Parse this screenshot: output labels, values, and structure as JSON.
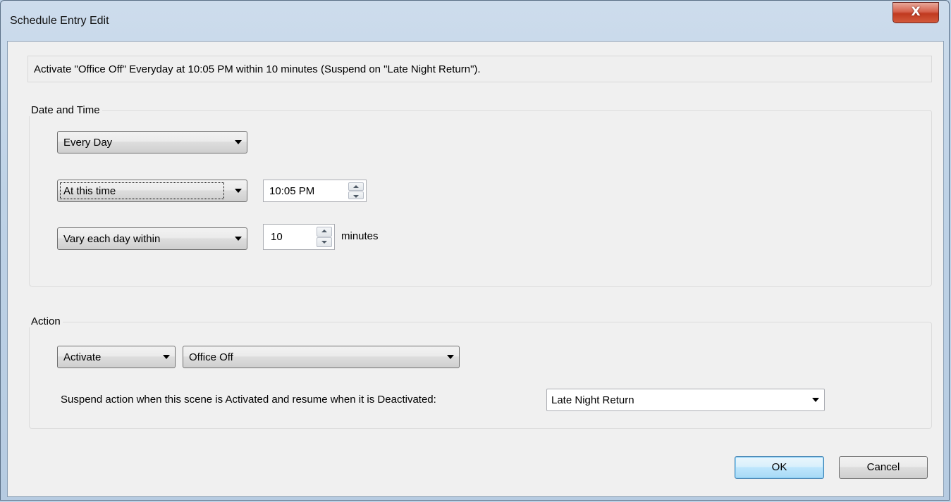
{
  "window": {
    "title": "Schedule Entry Edit",
    "close_label": "X"
  },
  "summary": "Activate \"Office Off\" Everyday at 10:05 PM within 10 minutes (Suspend on \"Late Night Return\").",
  "date_time": {
    "group_label": "Date and Time",
    "frequency": "Every Day",
    "time_mode": "At this time",
    "time_value": "10:05 PM",
    "variation_mode": "Vary each day within",
    "variation_value": "10",
    "variation_unit": "minutes"
  },
  "action": {
    "group_label": "Action",
    "action_type": "Activate",
    "scene": "Office Off",
    "suspend_label": "Suspend action when this scene is Activated and resume when it is Deactivated:",
    "suspend_scene": "Late Night Return"
  },
  "buttons": {
    "ok": "OK",
    "cancel": "Cancel"
  },
  "icons": {
    "close": "close-icon",
    "dropdown": "chevron-down-icon",
    "spin_up": "spin-up-icon",
    "spin_down": "spin-down-icon"
  }
}
